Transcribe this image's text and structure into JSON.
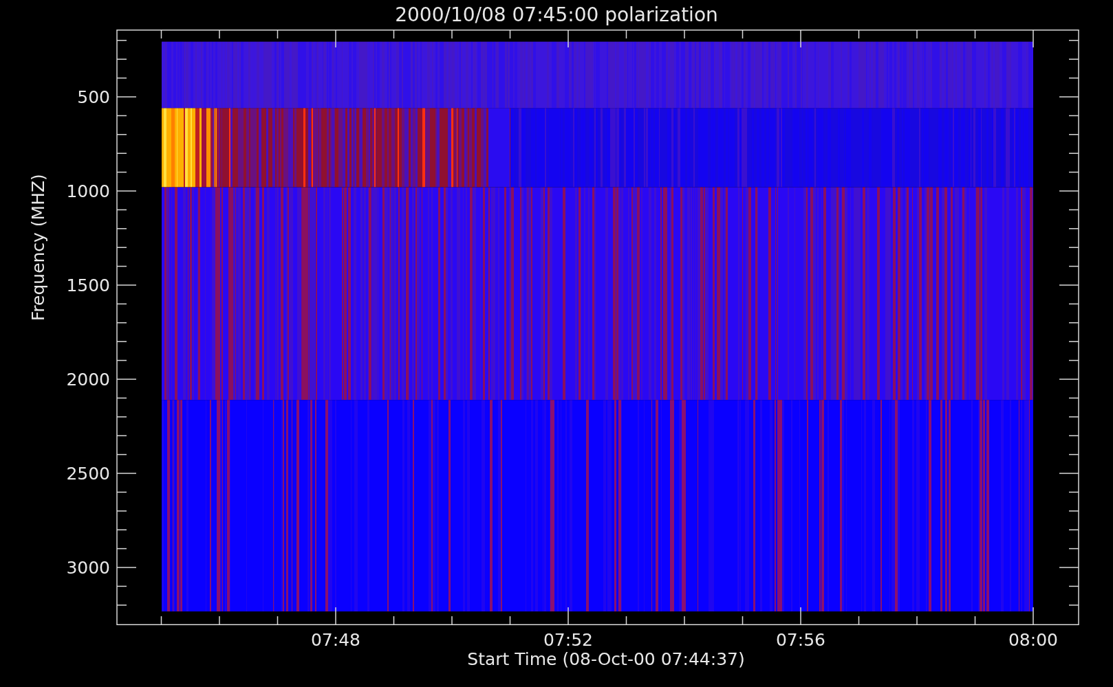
{
  "title": "2000/10/08 07:45:00 polarization",
  "y_axis": {
    "label": "Frequency (MHZ)",
    "ticks": [
      "500",
      "1000",
      "1500",
      "2000",
      "2500",
      "3000"
    ]
  },
  "x_axis": {
    "label": "Start Time (08-Oct-00 07:44:37)",
    "ticks": [
      "07:48",
      "07:52",
      "07:56",
      "08:00"
    ]
  }
}
